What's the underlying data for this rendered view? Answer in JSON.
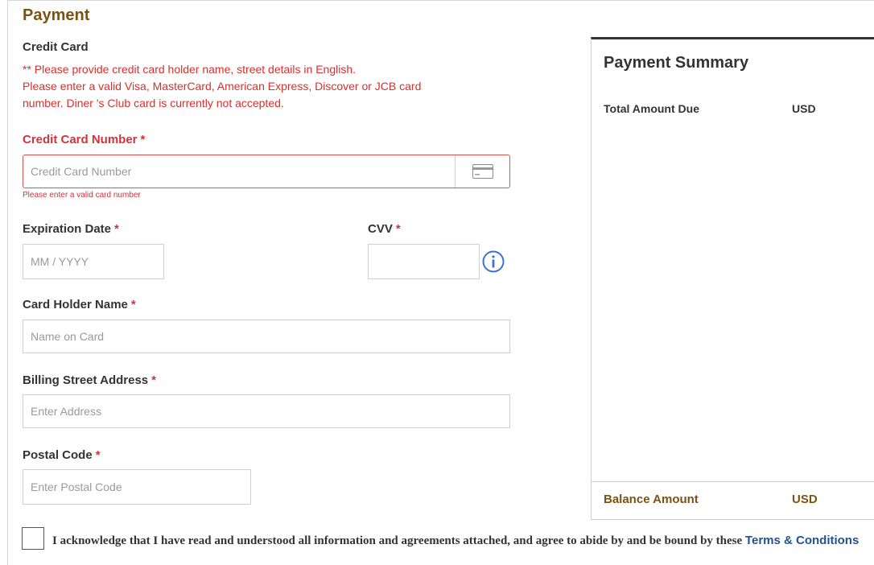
{
  "payment": {
    "title": "Payment",
    "credit_card_heading": "Credit Card",
    "notice": "** Please provide credit card holder name, street details in English.\nPlease enter a valid Visa, MasterCard, American Express, Discover or JCB card\nnumber. Diner 's Club card is currently not accepted.",
    "required_marker": "*",
    "card_number": {
      "label": "Credit Card Number",
      "placeholder": "Credit Card Number",
      "value": "",
      "error": "Please enter a valid card number",
      "icon": "credit-card-icon"
    },
    "expiration": {
      "label": "Expiration Date",
      "placeholder": "MM / YYYY",
      "value": ""
    },
    "cvv": {
      "label": "CVV",
      "placeholder": "",
      "value": "",
      "icon": "info-icon"
    },
    "holder": {
      "label": "Card Holder Name",
      "placeholder": "Name on Card",
      "value": ""
    },
    "address": {
      "label": "Billing Street Address",
      "placeholder": "Enter Address",
      "value": ""
    },
    "postal": {
      "label": "Postal Code",
      "placeholder": "Enter Postal Code",
      "value": ""
    }
  },
  "summary": {
    "title": "Payment Summary",
    "total_label": "Total Amount Due",
    "total_currency": "USD",
    "balance_label": "Balance Amount",
    "balance_currency": "USD"
  },
  "acknowledge": {
    "checked": false,
    "text": "I acknowledge that I have read and understood all information and agreements attached, and agree to abide by and be bound by these ",
    "link": "Terms & Conditions"
  },
  "colors": {
    "accent_brown": "#7a5313",
    "error_red": "#d2323a",
    "link_blue": "#23538f",
    "info_blue": "#3a73d1"
  }
}
